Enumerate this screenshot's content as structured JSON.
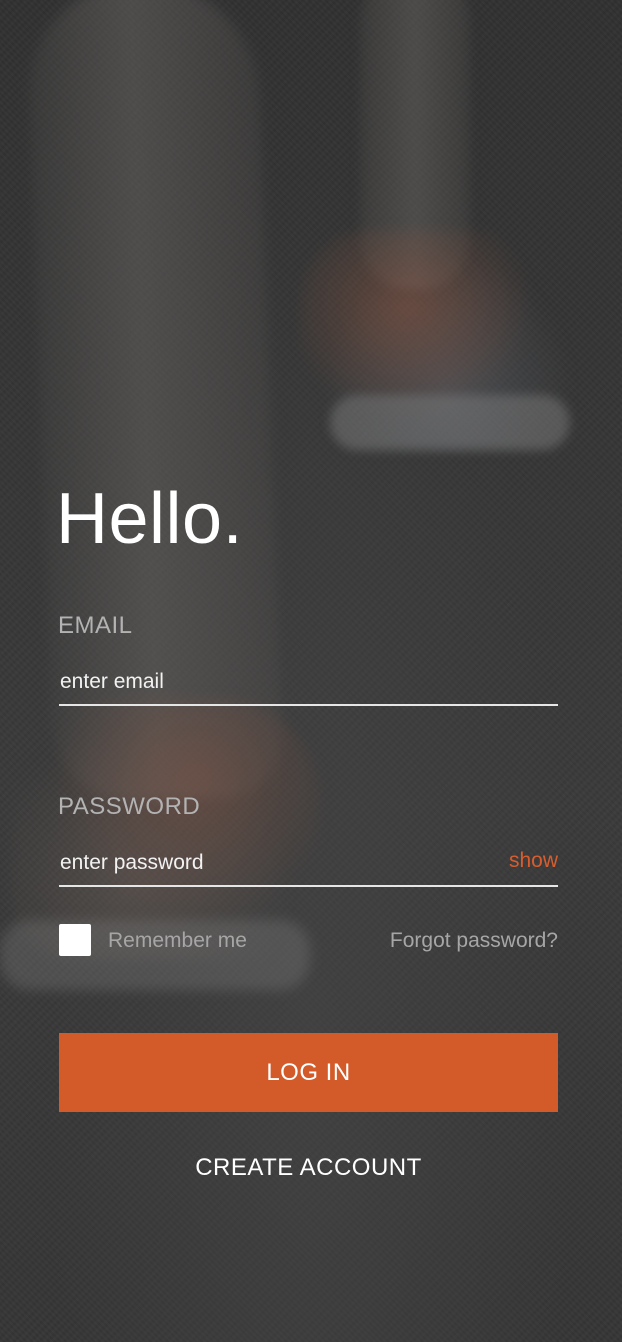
{
  "greeting": "Hello.",
  "email": {
    "label": "EMAIL",
    "placeholder": "enter email",
    "value": ""
  },
  "password": {
    "label": "PASSWORD",
    "placeholder": "enter password",
    "value": "",
    "show_label": "show"
  },
  "remember": {
    "label": "Remember me",
    "checked": false
  },
  "forgot_label": "Forgot password?",
  "login_label": "LOG IN",
  "create_account_label": "CREATE ACCOUNT",
  "colors": {
    "accent": "#d35a29",
    "show_link": "#d75d2e",
    "text_primary": "#ffffff",
    "text_muted": "#a6a6a6"
  }
}
